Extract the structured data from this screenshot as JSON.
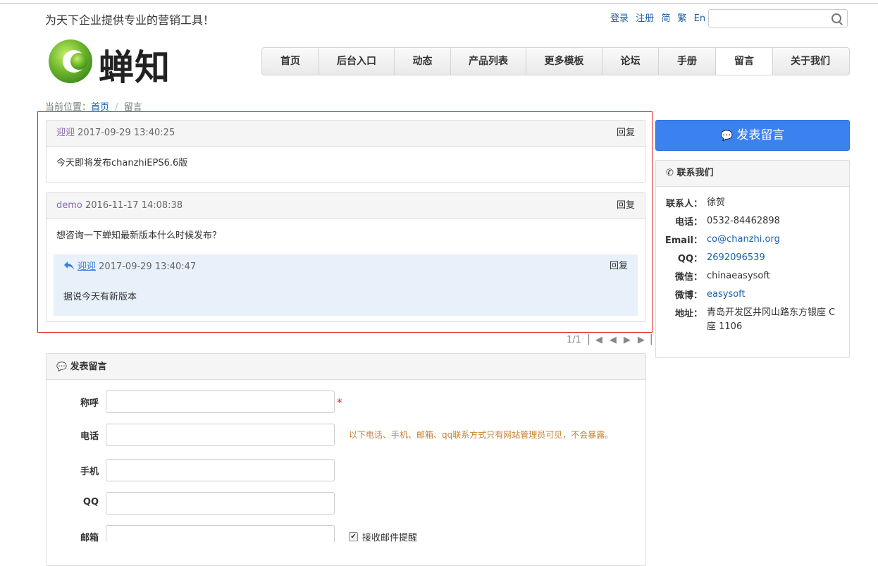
{
  "header": {
    "slogan": "为天下企业提供专业的营销工具！",
    "links": [
      "登录",
      "注册",
      "简",
      "繁",
      "En"
    ],
    "search_placeholder": ""
  },
  "logo": {
    "text": "蝉知",
    "color": "#5aa02c"
  },
  "nav": {
    "items": [
      "首页",
      "后台入口",
      "动态",
      "产品列表",
      "更多模板",
      "论坛",
      "手册",
      "留言",
      "关于我们"
    ],
    "active": "留言"
  },
  "breadcrumb": {
    "prefix": "当前位置：",
    "home": "首页",
    "sep": "/",
    "current": "留言"
  },
  "messages": [
    {
      "user": "迎迎",
      "time": "2017-09-29 13:40:25",
      "reply_label": "回复",
      "content": "今天即将发布chanzhiEPS6.6版"
    },
    {
      "user": "demo",
      "time": "2016-11-17 14:08:38",
      "reply_label": "回复",
      "content": "想咨询一下蝉知最新版本什么时候发布？",
      "replies": [
        {
          "user": "迎迎",
          "time": "2017-09-29 13:40:47",
          "reply_label": "回复",
          "content": "据说今天有新版本"
        }
      ]
    }
  ],
  "pager": {
    "text": "1/1"
  },
  "sidebar": {
    "post_button": "发表留言",
    "contact_title": "联系我们",
    "contact": [
      {
        "key": "联系人：",
        "value": "徐贺"
      },
      {
        "key": "电话：",
        "value": "0532-84462898"
      },
      {
        "key": "Email：",
        "value": "co@chanzhi.org"
      },
      {
        "key": "QQ：",
        "value": "2692096539"
      },
      {
        "key": "微信：",
        "value": "chinaeasysoft"
      },
      {
        "key": "微博：",
        "value": "easysoft"
      },
      {
        "key": "地址：",
        "value": "青岛开发区井冈山路东方银座 C座 1106"
      }
    ]
  },
  "form": {
    "title": "发表留言",
    "fields": [
      {
        "label": "称呼",
        "value": ""
      },
      {
        "label": "电话",
        "value": ""
      },
      {
        "label": "手机",
        "value": ""
      },
      {
        "label": "QQ",
        "value": ""
      },
      {
        "label": "邮箱",
        "value": ""
      }
    ],
    "required_mark": "*",
    "hint": "以下电话、手机、邮箱、qq联系方式只有网站管理员可见，不会暴露。",
    "email_notify_label": "接收邮件提醒"
  },
  "colors": {
    "accent": "#3b82f0",
    "link": "#1a5fa8",
    "username": "#8e6bb5",
    "highlight_border": "#e02020",
    "hint": "#c7802e"
  }
}
